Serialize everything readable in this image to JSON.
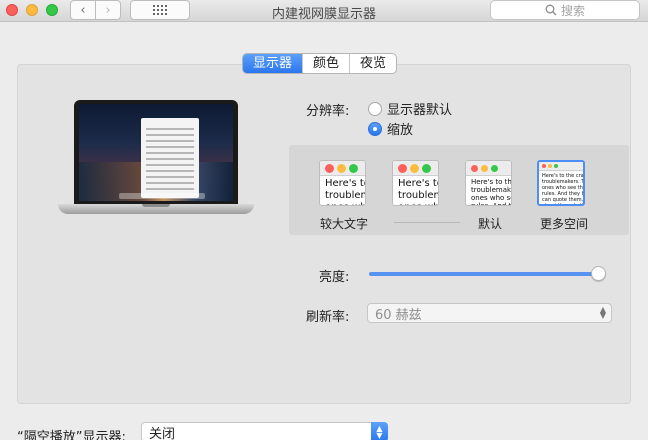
{
  "window": {
    "title": "内建视网膜显示器"
  },
  "search": {
    "placeholder": "搜索"
  },
  "tabs": [
    {
      "label": "显示器",
      "active": true
    },
    {
      "label": "颜色",
      "active": false
    },
    {
      "label": "夜览",
      "active": false
    }
  ],
  "resolution": {
    "label": "分辨率:",
    "options": [
      {
        "label": "显示器默认",
        "selected": false
      },
      {
        "label": "缩放",
        "selected": true
      }
    ]
  },
  "scale_options": [
    {
      "sample": "Here's to\ntroublem\nones who",
      "label": "较大文字"
    },
    {
      "sample": "Here's to th\ntroublemak\nones who s",
      "label": ""
    },
    {
      "sample": "Here's to the c\ntroublemakers.\nones who see t\nrules. And they",
      "label": "默认"
    },
    {
      "sample": "Here's to the crazy one\ntroublemakers. The rou\nones who see things di\nrules. And they have no\ncan quote them, disagre\nabout the only thing you\nBecause they change th",
      "label": "更多空间",
      "selected": true
    }
  ],
  "brightness": {
    "label": "亮度:",
    "level_fraction": 0.98
  },
  "refresh_rate": {
    "label": "刷新率:",
    "value": "60 赫兹"
  },
  "airplay": {
    "label": "“隔空播放”显示器:",
    "value": "关闭"
  },
  "colors": {
    "accent": "#2a76ef",
    "traffic_red": "#fc605c",
    "traffic_yellow": "#fdbc40",
    "traffic_green": "#34c84a"
  }
}
